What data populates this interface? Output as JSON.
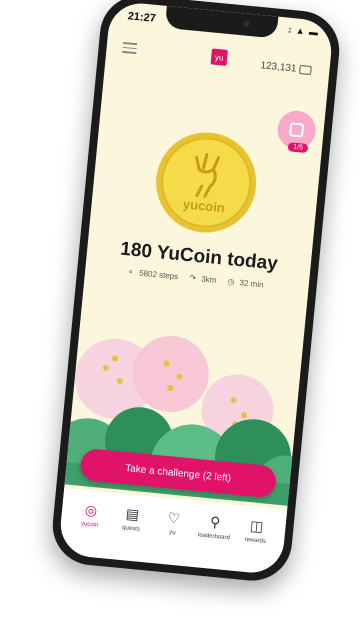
{
  "status_bar": {
    "time": "21:27",
    "icons": "⦂ ▲ ▬"
  },
  "header": {
    "logo": "yu",
    "balance": "123,131",
    "menu_icon": "hamburger-icon",
    "wallet_icon": "wallet-icon"
  },
  "quest_badge": {
    "count": "1/5",
    "icon": "calendar-icon"
  },
  "coin": {
    "label": "yucoin",
    "icon": "deer-icon"
  },
  "summary": {
    "title": "180 YuCoin today",
    "steps": "5802 steps",
    "distance": "3km",
    "time": "32 min"
  },
  "cta": {
    "label": "Take a challenge (2 left)"
  },
  "tabs": [
    {
      "label": "yucoin",
      "icon": "yucoin-icon",
      "active": true
    },
    {
      "label": "quests",
      "icon": "scroll-icon",
      "active": false
    },
    {
      "label": "yu",
      "icon": "heart-icon",
      "active": false
    },
    {
      "label": "leaderboard",
      "icon": "trophy-icon",
      "active": false
    },
    {
      "label": "rewards",
      "icon": "gift-icon",
      "active": false
    }
  ],
  "colors": {
    "accent": "#e0126a",
    "background": "#fbf6dc",
    "coin": "#f2d43a",
    "trees": "#3f9f6a"
  }
}
